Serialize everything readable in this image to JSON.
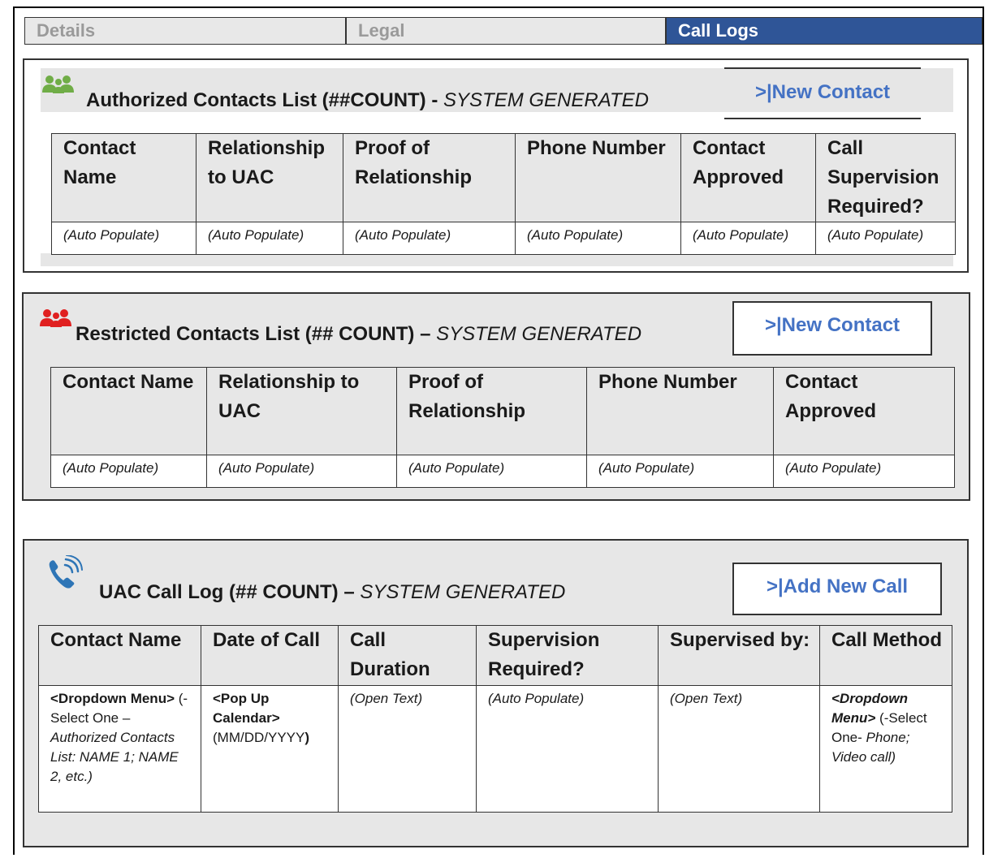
{
  "tabs": [
    {
      "label": "Details"
    },
    {
      "label": "Legal"
    },
    {
      "label": "Call Logs"
    }
  ],
  "authorized": {
    "title": "Authorized Contacts List (##COUNT) -",
    "suffix": "SYSTEM GENERATED",
    "button": ">|New Contact",
    "icon": "group-icon",
    "icon_color": "#70ad47",
    "headers": [
      "Contact Name",
      "Relationship to UAC",
      "Proof of Relationship",
      "Phone Number",
      "Contact Approved",
      "Call Supervision Required?"
    ],
    "row": [
      "(Auto Populate)",
      "(Auto Populate)",
      "(Auto Populate)",
      "(Auto Populate)",
      "(Auto Populate)",
      "(Auto Populate)"
    ]
  },
  "restricted": {
    "title": "Restricted Contacts List (## COUNT) –",
    "suffix": "SYSTEM GENERATED",
    "button": ">|New Contact",
    "icon": "group-icon",
    "icon_color": "#e02020",
    "headers": [
      "Contact Name",
      "Relationship to UAC",
      "Proof of Relationship",
      "Phone Number",
      "Contact Approved"
    ],
    "row": [
      "(Auto Populate)",
      "(Auto Populate)",
      "(Auto Populate)",
      "(Auto Populate)",
      "(Auto Populate)"
    ]
  },
  "calllog": {
    "title": "UAC Call Log (## COUNT) –",
    "suffix": "SYSTEM GENERATED",
    "button": ">|Add New Call",
    "icon": "phone-icon",
    "icon_color": "#2e75b6",
    "headers": [
      "Contact Name",
      "Date of Call",
      "Call Duration",
      "Supervision Required?",
      "Supervised by:",
      "Call Method"
    ],
    "c1": {
      "dd": "<Dropdown Menu>",
      "pre": "(-Select One –",
      "list": "Authorized Contacts List: NAME 1; NAME 2, etc.)"
    },
    "c2": {
      "popup": "<Pop Up Calendar>",
      "fmt": "(MM/DD/YYYY",
      "close": ")"
    },
    "c3": "(Open Text)",
    "c4": "(Auto Populate)",
    "c5": "(Open Text)",
    "c6": {
      "dd": "<Dropdown Menu>",
      "pre": "(-Select One-",
      "opts": "Phone; Video call)"
    }
  },
  "colors": {
    "accent": "#2f5597",
    "link": "#4472c4",
    "panel": "#e7e7e7"
  }
}
